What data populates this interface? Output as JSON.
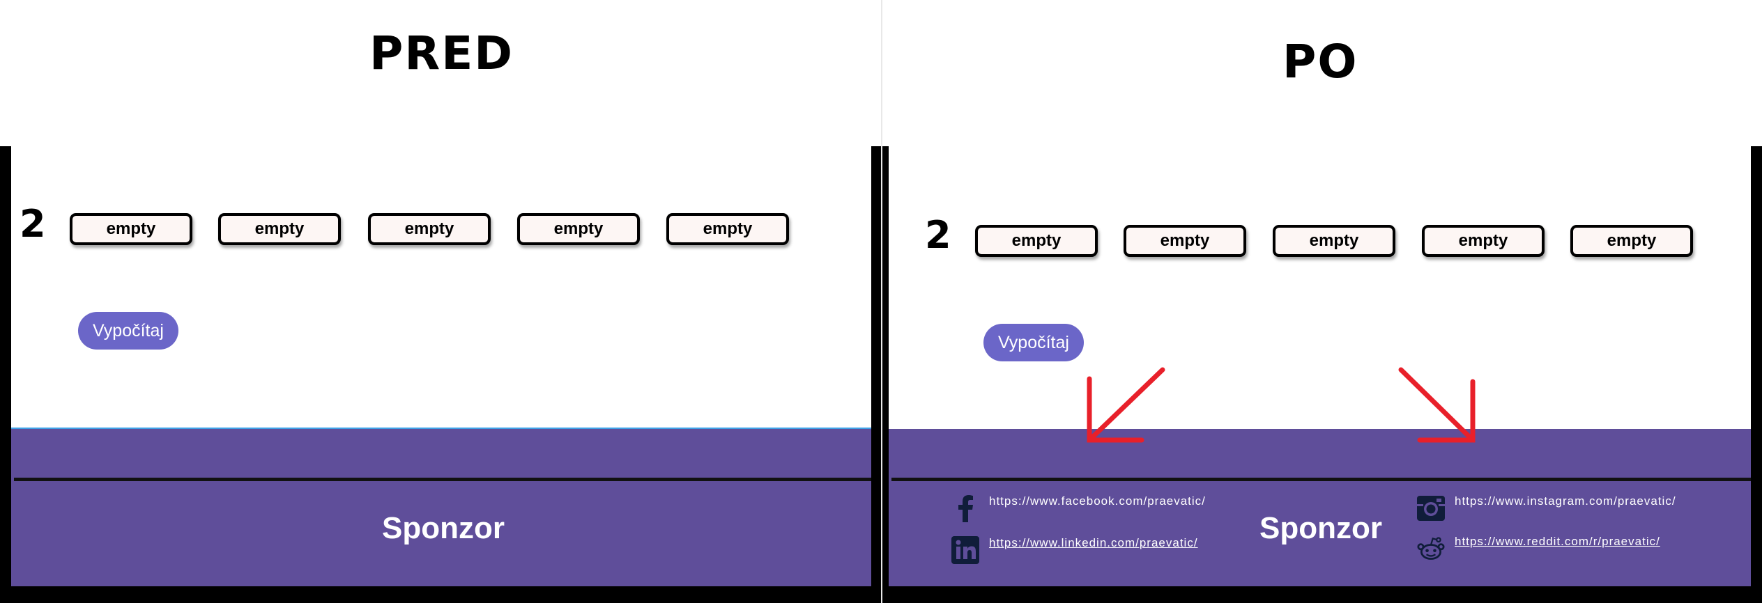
{
  "headings": {
    "before": "PRED",
    "after": "PO"
  },
  "row": {
    "number": "2",
    "cells": [
      "empty",
      "empty",
      "empty",
      "empty",
      "empty"
    ]
  },
  "calculate_label": "Vypočítaj",
  "footer": {
    "sponsor": "Sponzor",
    "links": {
      "facebook": "https://www.facebook.com/praevatic/",
      "linkedin": "https://www.linkedin.com/praevatic/",
      "instagram": "https://www.instagram.com/praevatic/",
      "reddit": "https://www.reddit.com/r/praevatic/"
    }
  },
  "colors": {
    "footer_bg": "#5f4e9a",
    "button_bg": "#6b66c8",
    "arrow": "#e8202a",
    "cell_bg": "#fdf6f4",
    "highlight_line": "#3fa0e6"
  },
  "icons": [
    "facebook-icon",
    "linkedin-icon",
    "instagram-icon",
    "reddit-icon",
    "arrow-down-left-icon",
    "arrow-down-right-icon"
  ]
}
